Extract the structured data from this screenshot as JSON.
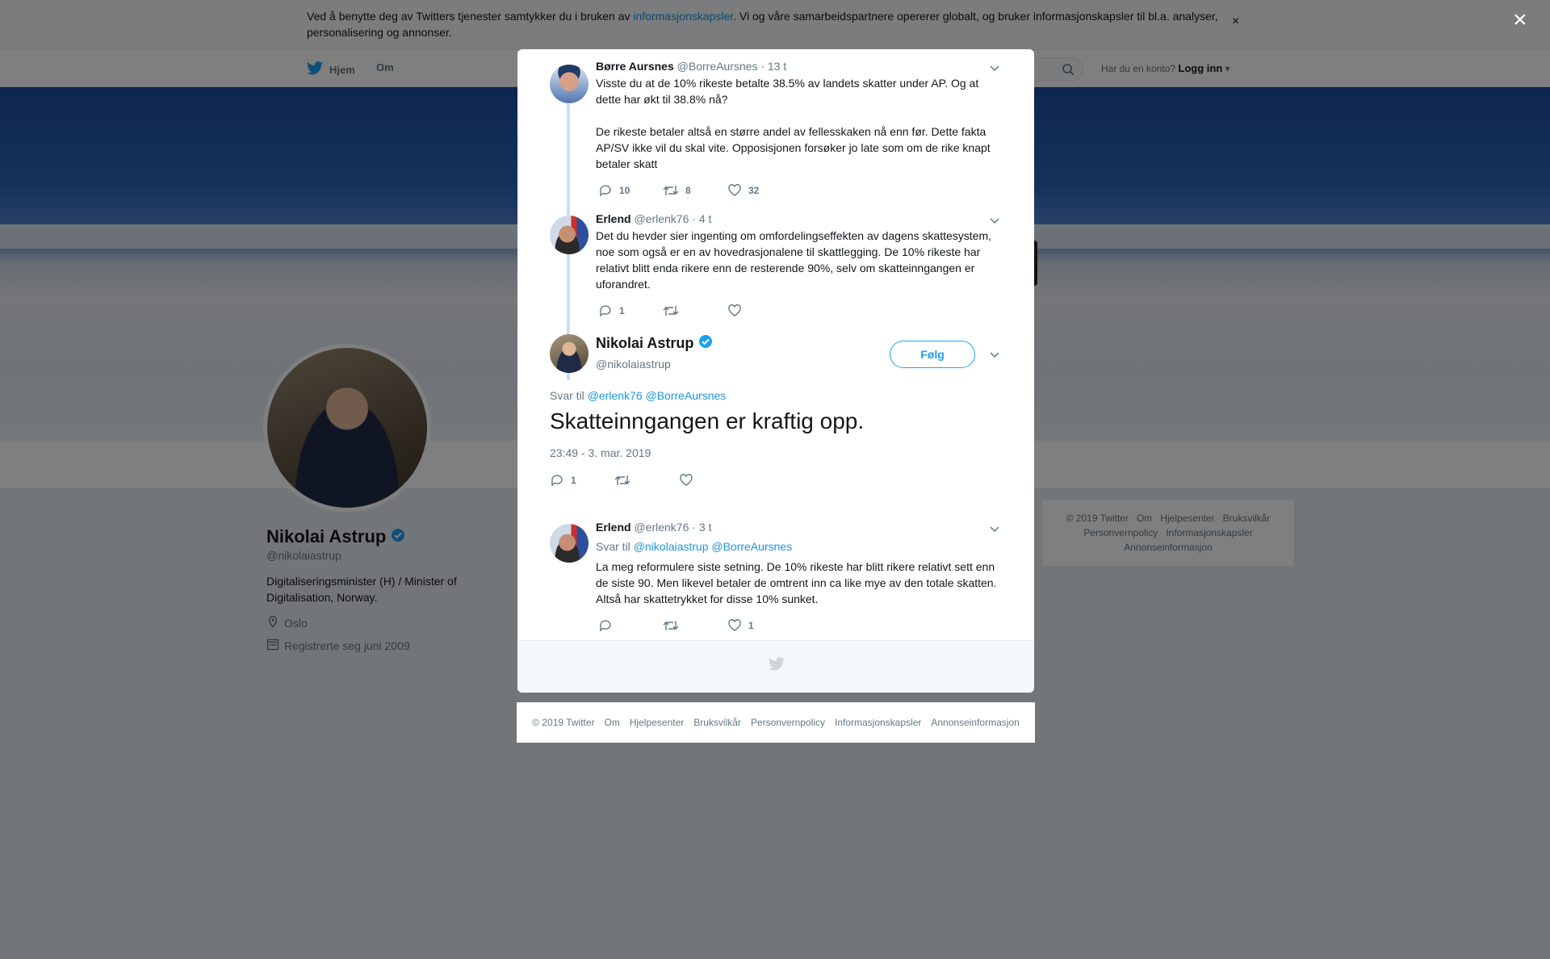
{
  "cookie": {
    "text_before": "Ved å benytte deg av Twitters tjenester samtykker du i bruken av ",
    "link": "informasjonskapsler",
    "text_after": ". Vi og våre samarbeidspartnere opererer globalt, og bruker informasjonskapsler til bl.a. analyser, personalisering og annonser.",
    "close": "×"
  },
  "nav": {
    "home": "Hjem",
    "about": "Om",
    "login_prompt": "Har du en konto?",
    "login": "Logg inn"
  },
  "profile": {
    "name": "Nikolai Astrup",
    "handle": "@nikolaiastrup",
    "bio": "Digitaliseringsminister (H) / Minister of Digitalisation, Norway.",
    "location": "Oslo",
    "joined": "Registrerte seg juni 2009"
  },
  "side_footer": [
    "© 2019 Twitter",
    "Om",
    "Hjelpesenter",
    "Bruksvilkår",
    "Personvernpolicy",
    "Informasjonskapsler",
    "Annonseinformasjon"
  ],
  "page_close": "×",
  "tweets": [
    {
      "name": "Børre Aursnes",
      "handle": "@BorreAursnes",
      "time": "· 13 t",
      "paragraphs": [
        "Visste du at de 10% rikeste betalte 38.5% av landets skatter under AP. Og at dette har økt til 38.8% nå?",
        "De rikeste betaler altså en større andel av fellesskaken nå enn før. Dette fakta AP/SV ikke vil du skal vite. Opposisjonen forsøker jo late som om de rike knapt betaler skatt"
      ],
      "replies": "10",
      "retweets": "8",
      "likes": "32"
    },
    {
      "name": "Erlend",
      "handle": "@erlenk76",
      "time": "· 4 t",
      "paragraphs": [
        "Det du hevder sier ingenting om omfordelingseffekten av dagens skattesystem, noe som også er en av hovedrasjonalene til skattlegging. De 10% rikeste har relativt blitt enda rikere enn de resterende 90%, selv om skatteinngangen er uforandret."
      ],
      "replies": "1",
      "retweets": "",
      "likes": ""
    }
  ],
  "main_tweet": {
    "name": "Nikolai Astrup",
    "handle": "@nikolaiastrup",
    "follow": "Følg",
    "reply_prefix": "Svar til",
    "reply_users": "@erlenk76 @BorreAursnes",
    "text": "Skatteinngangen er kraftig opp.",
    "timestamp": "23:49 - 3. mar. 2019",
    "replies": "1",
    "retweets": "",
    "likes": ""
  },
  "reply_tweet": {
    "name": "Erlend",
    "handle": "@erlenk76",
    "time": "· 3 t",
    "reply_prefix": "Svar til",
    "reply_users": "@nikolaiastrup @BorreAursnes",
    "text": "La meg reformulere siste setning. De 10% rikeste har blitt rikere relativt sett enn de siste 90. Men likevel betaler de omtrent inn ca like mye av den totale skatten. Altså har skattetrykket for disse 10% sunket.",
    "replies": "",
    "retweets": "",
    "likes": "1"
  },
  "bottom_footer": [
    "© 2019 Twitter",
    "Om",
    "Hjelpesenter",
    "Bruksvilkår",
    "Personvernpolicy",
    "Informasjonskapsler",
    "Annonseinformasjon"
  ],
  "colors": {
    "twitter_blue": "#1da1f2",
    "link": "#1b95e0",
    "thread_line": "#c4e2f5",
    "muted": "#657786"
  },
  "icons": [
    "twitter-bird-icon",
    "search-icon",
    "verified-badge-icon",
    "location-icon",
    "calendar-icon",
    "reply-icon",
    "retweet-icon",
    "like-icon",
    "chevron-down-icon",
    "close-icon"
  ]
}
